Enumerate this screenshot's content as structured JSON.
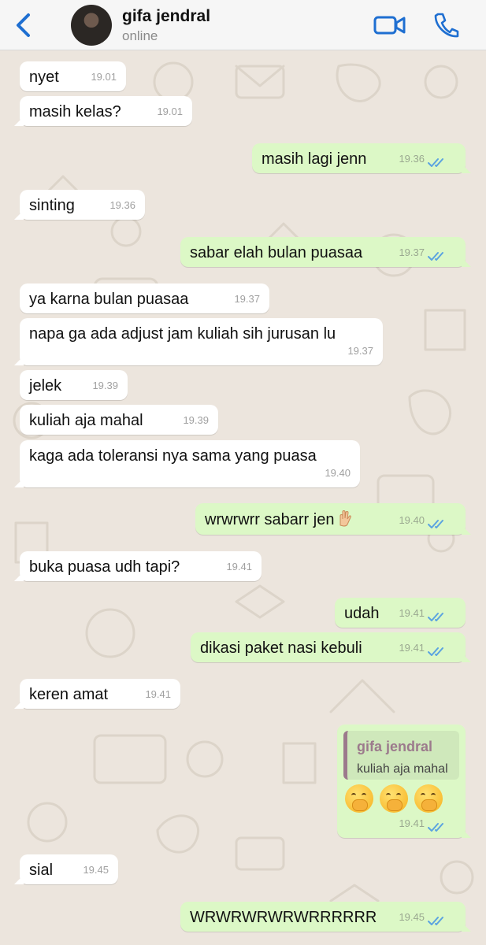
{
  "header": {
    "contact_name": "gifa jendral",
    "status": "online"
  },
  "colors": {
    "accent": "#1f6fd1",
    "incoming_bubble": "#ffffff",
    "outgoing_bubble": "#dcf8c6",
    "wallpaper": "#ece5dd",
    "read_ticks": "#5ba3e0"
  },
  "messages": [
    {
      "dir": "in",
      "text": "nyet",
      "time": "19.01"
    },
    {
      "dir": "in",
      "text": "masih kelas?",
      "time": "19.01"
    },
    {
      "dir": "out",
      "text": "masih lagi jenn",
      "time": "19.36",
      "ticks": "read"
    },
    {
      "dir": "in",
      "text": "sinting",
      "time": "19.36"
    },
    {
      "dir": "out",
      "text": "sabar elah bulan puasaa",
      "time": "19.37",
      "ticks": "read"
    },
    {
      "dir": "in",
      "text": "ya karna bulan puasaa",
      "time": "19.37"
    },
    {
      "dir": "in",
      "text": "napa ga ada adjust jam kuliah sih jurusan lu",
      "time": "19.37"
    },
    {
      "dir": "in",
      "text": "jelek",
      "time": "19.39"
    },
    {
      "dir": "in",
      "text": "kuliah aja mahal",
      "time": "19.39"
    },
    {
      "dir": "in",
      "text": "kaga ada toleransi nya sama yang puasa",
      "time": "19.40"
    },
    {
      "dir": "out",
      "text": "wrwrwrr sabarr jen",
      "emoji": "raised-hand-emoji",
      "time": "19.40",
      "ticks": "read"
    },
    {
      "dir": "in",
      "text": "buka puasa udh tapi?",
      "time": "19.41"
    },
    {
      "dir": "out",
      "text": "udah",
      "time": "19.41",
      "ticks": "read"
    },
    {
      "dir": "out",
      "text": "dikasi paket nasi kebuli",
      "time": "19.41",
      "ticks": "read"
    },
    {
      "dir": "in",
      "text": "keren amat",
      "time": "19.41"
    },
    {
      "dir": "out",
      "reply_to": {
        "name": "gifa jendral",
        "text": "kuliah aja mahal"
      },
      "emojis": [
        "hand-over-mouth-emoji",
        "hand-over-mouth-emoji",
        "hand-over-mouth-emoji"
      ],
      "time": "19.41",
      "ticks": "read"
    },
    {
      "dir": "in",
      "text": "sial",
      "time": "19.45"
    },
    {
      "dir": "out",
      "text": "WRWRWRWRWRRRRRR",
      "time": "19.45",
      "ticks": "read"
    }
  ]
}
